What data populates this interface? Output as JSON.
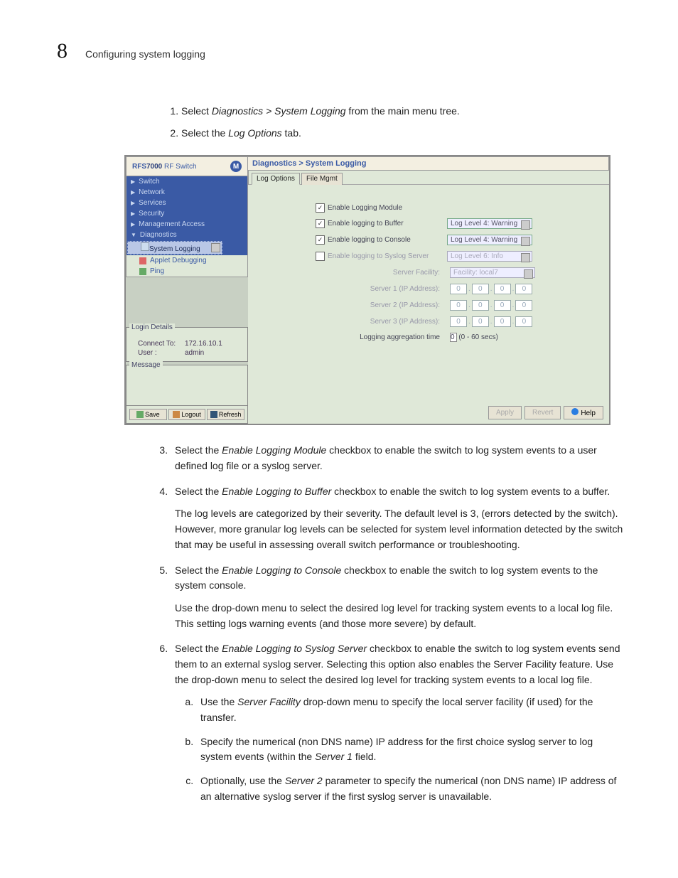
{
  "header": {
    "chapter_number": "8",
    "chapter_title": "Configuring system logging"
  },
  "intro_steps": [
    {
      "prefix": "Select ",
      "italic": "Diagnostics > System Logging",
      "suffix": " from the main menu tree."
    },
    {
      "prefix": "Select the ",
      "italic": "Log Options",
      "suffix": " tab."
    }
  ],
  "screenshot": {
    "product_prefix": "RFS",
    "product_bold": "7000",
    "product_suffix": " RF Switch",
    "nav": [
      {
        "label": "Switch",
        "type": "top"
      },
      {
        "label": "Network",
        "type": "top"
      },
      {
        "label": "Services",
        "type": "top"
      },
      {
        "label": "Security",
        "type": "top"
      },
      {
        "label": "Management Access",
        "type": "top"
      },
      {
        "label": "Diagnostics",
        "type": "top_open"
      },
      {
        "label": "System Logging",
        "type": "child_sel"
      },
      {
        "label": "Applet Debugging",
        "type": "child"
      },
      {
        "label": "Ping",
        "type": "child"
      }
    ],
    "login": {
      "legend": "Login Details",
      "connect_label": "Connect To:",
      "connect_value": "172.16.10.1",
      "user_label": "User :",
      "user_value": "admin"
    },
    "message_legend": "Message",
    "sb_buttons": {
      "save": "Save",
      "logout": "Logout",
      "refresh": "Refresh"
    },
    "breadcrumb": "Diagnostics > System Logging",
    "tabs": [
      {
        "label": "Log Options",
        "active": true
      },
      {
        "label": "File Mgmt",
        "active": false
      }
    ],
    "form": {
      "enable_module": "Enable Logging Module",
      "enable_buffer": "Enable logging to Buffer",
      "buffer_level": "Log Level 4: Warning",
      "enable_console": "Enable logging to Console",
      "console_level": "Log Level 4: Warning",
      "enable_syslog": "Enable logging to Syslog Server",
      "syslog_level": "Log Level 6: Info",
      "server_facility_label": "Server Facility:",
      "server_facility_value": "Facility: local7",
      "server1_label": "Server 1 (IP Address):",
      "server2_label": "Server 2 (IP Address):",
      "server3_label": "Server 3 (IP Address):",
      "ip_zero": [
        "0",
        "0",
        "0",
        "0"
      ],
      "agg_label": "Logging aggregation time",
      "agg_value": "0",
      "agg_hint": "(0 - 60 secs)"
    },
    "footer": {
      "apply": "Apply",
      "revert": "Revert",
      "help": "Help"
    }
  },
  "body_steps": {
    "s3": {
      "pre": "Select the ",
      "it": "Enable Logging Module",
      "post": " checkbox to enable the switch to log system events to a user defined log file or a syslog server."
    },
    "s4": {
      "pre": "Select the ",
      "it": "Enable Logging to Buffer",
      "post": " checkbox to enable the switch to log system events to a buffer.",
      "para": "The log levels are categorized by their severity. The default level is 3, (errors detected by the switch). However, more granular log levels can be selected for system level information detected by the switch that may be useful in assessing overall switch performance or troubleshooting."
    },
    "s5": {
      "pre": "Select the ",
      "it": "Enable Logging to Console",
      "post": " checkbox to enable the switch to log system events to the system console.",
      "para": "Use the drop-down menu to select the desired log level for tracking system events to a local log file. This setting logs warning events (and those more severe) by default."
    },
    "s6": {
      "pre": "Select the ",
      "it": "Enable Logging to Syslog Server",
      "post": " checkbox to enable the switch to log system events send them to an external syslog server. Selecting this option also enables the Server Facility feature. Use the drop-down menu to select the desired log level for tracking system events to a local log file.",
      "sub": [
        {
          "pre": "Use the ",
          "it": "Server Facility",
          "post": " drop-down menu to specify the local server facility (if used) for the transfer."
        },
        {
          "pre": "Specify the numerical (non DNS name) IP address for the first choice syslog server to log system events (within the ",
          "it": "Server 1",
          "post": " field."
        },
        {
          "pre": "Optionally, use the ",
          "it": "Server 2",
          "post": " parameter to specify the numerical (non DNS name) IP address of an alternative syslog server if the first syslog server is unavailable."
        }
      ]
    }
  }
}
